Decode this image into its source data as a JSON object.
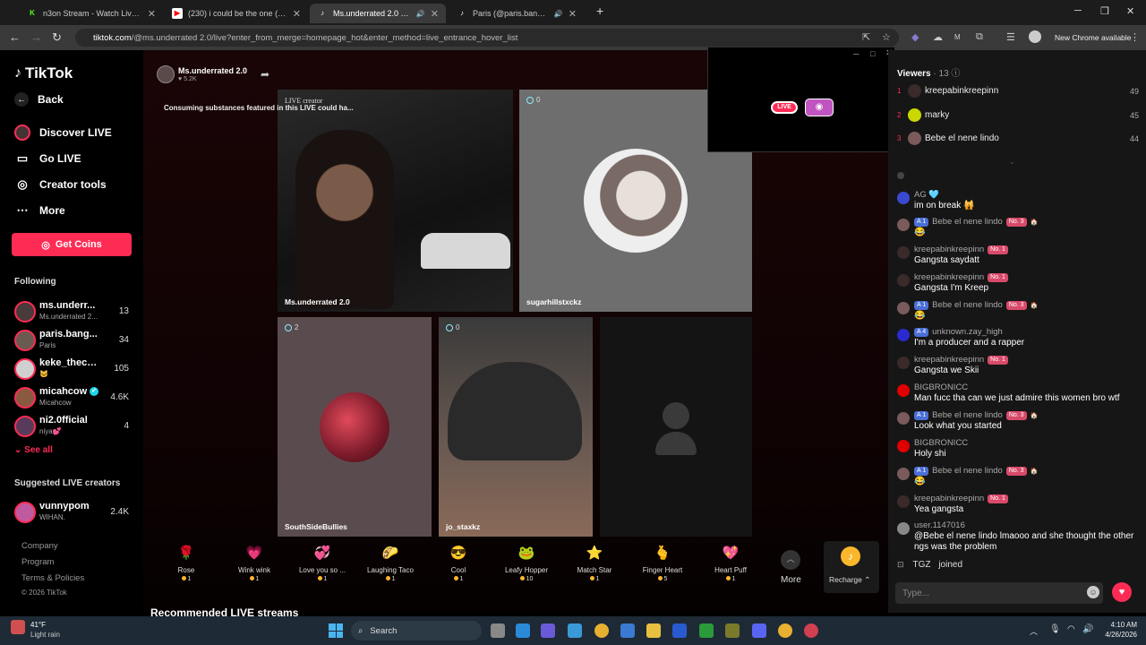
{
  "tabs": [
    {
      "title": "n3on Stream - Watch Live on K",
      "favicon": "K",
      "color": "#53fc18"
    },
    {
      "title": "(230) i could be the one (Ambe",
      "favicon": "▶",
      "color": "#ff0000"
    },
    {
      "title": "Ms.underrated 2.0 (@ms.u",
      "favicon": "♪",
      "color": "#ffffff"
    },
    {
      "title": "Paris (@paris.bangaa2) is LI",
      "favicon": "♪",
      "color": "#ffffff"
    }
  ],
  "address": {
    "host": "tiktok.com",
    "path": "/@ms.underrated 2.0/live?enter_from_merge=homepage_hot&enter_method=live_entrance_hover_list",
    "chrome_update": "New Chrome available"
  },
  "nav": {
    "logo": "TikTok",
    "back": "Back",
    "discover": "Discover LIVE",
    "golive": "Go LIVE",
    "creator": "Creator tools",
    "more": "More",
    "getcoins": "Get Coins",
    "following_title": "Following",
    "following": [
      {
        "name": "ms.underr...",
        "sub": "Ms.underrated 2...",
        "count": "13",
        "color": "#4a3a3a"
      },
      {
        "name": "paris.bang...",
        "sub": "Paris",
        "count": "34",
        "color": "#6a5a50"
      },
      {
        "name": "keke_theco...",
        "sub": "🐱",
        "count": "105",
        "color": "#d0d0d0"
      },
      {
        "name": "micahcow",
        "sub": "Micahcow",
        "count": "4.6K",
        "color": "#8a5a40"
      },
      {
        "name": "ni2.0fficial",
        "sub": "niya💕",
        "count": "4",
        "color": "#5a3a5a"
      }
    ],
    "see_all": "See all",
    "suggested_title": "Suggested LIVE creators",
    "suggested": [
      {
        "name": "vunnypom",
        "sub": "WIHAN.",
        "count": "2.4K",
        "color": "#c05aa0"
      }
    ],
    "footer": [
      "Company",
      "Program",
      "Terms & Policies",
      "© 2026 TikTok"
    ]
  },
  "main": {
    "host_name": "Ms.underrated 2.0",
    "host_likes": "5.2K",
    "warning": "Consuming substances featured in this LIVE could ha...",
    "live_creator": "LIVE creator",
    "tiles": [
      {
        "label": "Ms.underrated 2.0",
        "badge": ""
      },
      {
        "label": "sugarhillstxckz",
        "badge": "0"
      },
      {
        "label": "SouthSideBullies",
        "badge": "2"
      },
      {
        "label": "jo_staxkz",
        "badge": "0"
      }
    ],
    "gifts": [
      {
        "name": "Rose",
        "price": "1",
        "icon": "🌹"
      },
      {
        "name": "Wink wink",
        "price": "1",
        "icon": "💗"
      },
      {
        "name": "Love you so ...",
        "price": "1",
        "icon": "💞"
      },
      {
        "name": "Laughing Taco",
        "price": "1",
        "icon": "🌮"
      },
      {
        "name": "Cool",
        "price": "1",
        "icon": "😎"
      },
      {
        "name": "Leafy Hopper",
        "price": "10",
        "icon": "🐸"
      },
      {
        "name": "Match Star",
        "price": "1",
        "icon": "⭐"
      },
      {
        "name": "Finger Heart",
        "price": "5",
        "icon": "🫰"
      },
      {
        "name": "Heart Puff",
        "price": "1",
        "icon": "💖"
      }
    ],
    "gift_more": "More",
    "recharge": "Recharge",
    "recommended": "Recommended LIVE streams"
  },
  "popup": {
    "live": "LIVE"
  },
  "viewers": {
    "title": "Viewers",
    "count": "13",
    "list": [
      {
        "rank": "1",
        "name": "kreepabinkreepinn",
        "score": "49",
        "color": "#3a2a2a"
      },
      {
        "rank": "2",
        "name": "marky",
        "score": "45",
        "color": "#c8d800"
      },
      {
        "rank": "3",
        "name": "Bebe el nene lindo",
        "score": "44",
        "color": "#7a5a5a"
      }
    ]
  },
  "chat": [
    {
      "name": "",
      "msg": "",
      "lv": "",
      "no": "",
      "color": "#444"
    },
    {
      "name": "AG 🩵",
      "msg": "im on break 🙀",
      "lv": "",
      "no": "",
      "color": "#3a4ad0"
    },
    {
      "name": "Bebe el nene lindo",
      "msg": "😂",
      "lv": "1",
      "no": "No. 3",
      "color": "#7a5a5a"
    },
    {
      "name": "kreepabinkreepinn",
      "msg": "Gangsta saydatt",
      "lv": "",
      "no": "No. 1",
      "color": "#3a2a2a"
    },
    {
      "name": "kreepabinkreepinn",
      "msg": "Gangsta I'm Kreep",
      "lv": "",
      "no": "No. 1",
      "color": "#3a2a2a"
    },
    {
      "name": "Bebe el nene lindo",
      "msg": "😂",
      "lv": "1",
      "no": "No. 3",
      "color": "#7a5a5a"
    },
    {
      "name": "unknown.zay_high",
      "msg": "I'm a producer and a rapper",
      "lv": "4",
      "no": "",
      "color": "#2a2ad0"
    },
    {
      "name": "kreepabinkreepinn",
      "msg": "Gangsta we Skii",
      "lv": "",
      "no": "No. 1",
      "color": "#3a2a2a"
    },
    {
      "name": "BIGBRONICC",
      "msg": "Man fucc tha can we just admire this women bro wtf",
      "lv": "",
      "no": "",
      "color": "#e00000"
    },
    {
      "name": "Bebe el nene lindo",
      "msg": "Look what you started",
      "lv": "1",
      "no": "No. 3",
      "color": "#7a5a5a"
    },
    {
      "name": "BIGBRONICC",
      "msg": "Holy shi",
      "lv": "",
      "no": "",
      "color": "#e00000"
    },
    {
      "name": "Bebe el nene lindo",
      "msg": "😂",
      "lv": "1",
      "no": "No. 3",
      "color": "#7a5a5a"
    },
    {
      "name": "kreepabinkreepinn",
      "msg": "Yea gangsta",
      "lv": "",
      "no": "No. 1",
      "color": "#3a2a2a"
    },
    {
      "name": "user.1147016",
      "msg": "@Bebe el nene lindo lmaooo and she thought the other ngs was the problem",
      "lv": "",
      "no": "",
      "color": "#888"
    }
  ],
  "joined": {
    "name": "TGZ",
    "text": "joined"
  },
  "chat_input": {
    "placeholder": "Type..."
  },
  "taskbar": {
    "temp": "41°F",
    "weather": "Light rain",
    "search": "Search",
    "time": "4:10 AM",
    "date": "4/26/2026"
  }
}
